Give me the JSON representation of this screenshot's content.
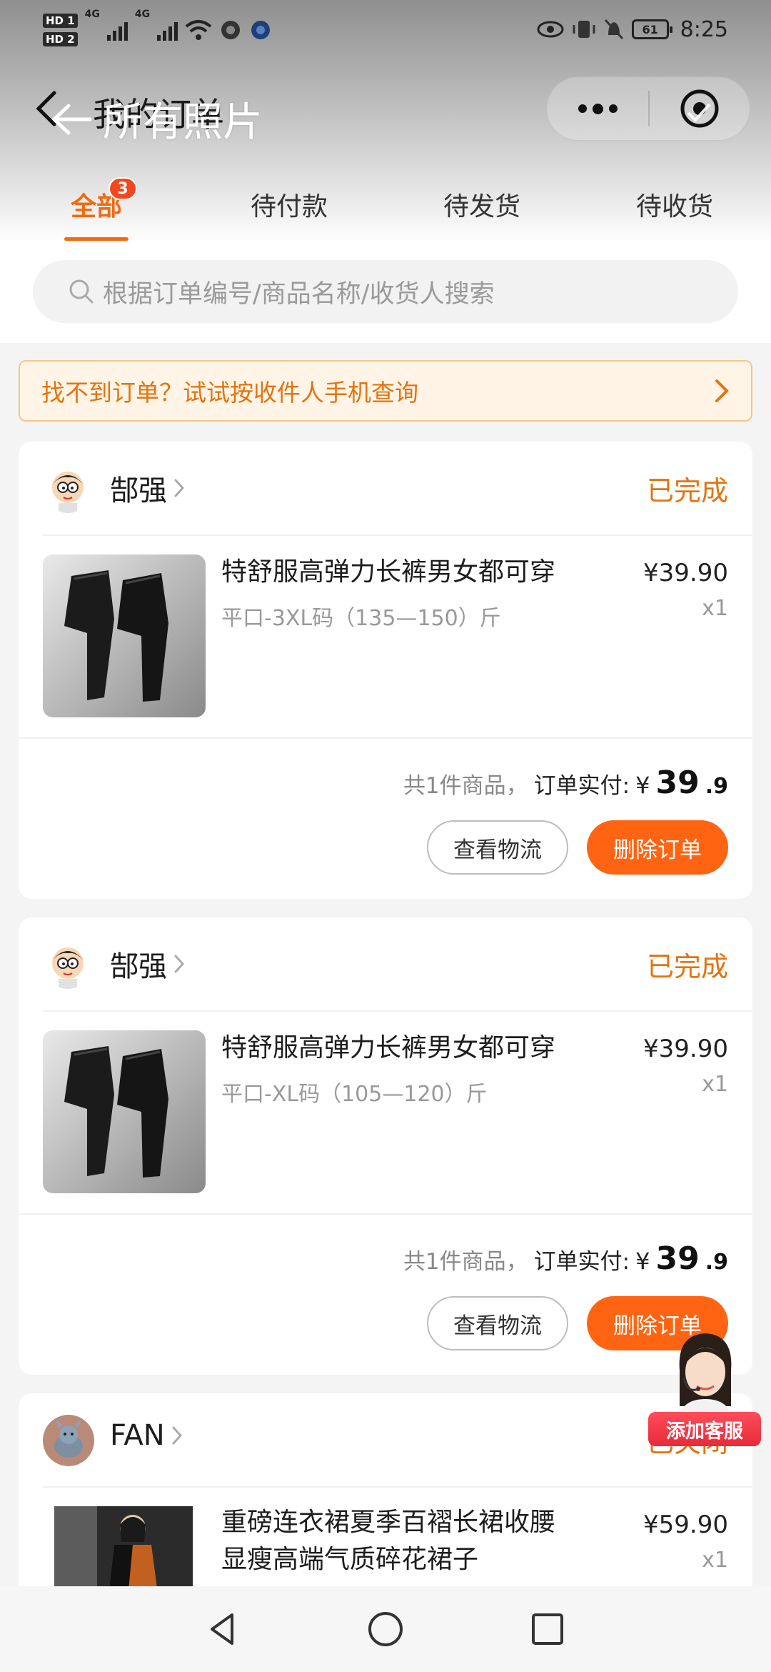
{
  "status_bar": {
    "hd1": "HD 1",
    "hd2": "HD 2",
    "net1": "4G",
    "net2": "4G",
    "battery": "61",
    "time": "8:25"
  },
  "header": {
    "title": "我的订单",
    "overlay_title": "所有照片"
  },
  "tabs": [
    {
      "label": "全部",
      "badge": "3",
      "active": true
    },
    {
      "label": "待付款"
    },
    {
      "label": "待发货"
    },
    {
      "label": "待收货"
    }
  ],
  "search": {
    "placeholder": "根据订单编号/商品名称/收货人搜索"
  },
  "notice": {
    "text": "找不到订单？试试按收件人手机查询"
  },
  "orders": [
    {
      "shop": "郜强",
      "status": "已完成",
      "product_title": "特舒服高弹力长裤男女都可穿",
      "spec": "平口-3XL码（135—150）斤",
      "price": "¥39.90",
      "qty": "x1",
      "summary_count": "共1件商品，",
      "summary_paid": "订单实付:",
      "summary_yen": "¥",
      "summary_int": "39",
      "summary_dec": ".9",
      "btn_logistics": "查看物流",
      "btn_delete": "删除订单"
    },
    {
      "shop": "郜强",
      "status": "已完成",
      "product_title": "特舒服高弹力长裤男女都可穿",
      "spec": "平口-XL码（105—120）斤",
      "price": "¥39.90",
      "qty": "x1",
      "summary_count": "共1件商品，",
      "summary_paid": "订单实付:",
      "summary_yen": "¥",
      "summary_int": "39",
      "summary_dec": ".9",
      "btn_logistics": "查看物流",
      "btn_delete": "删除订单"
    },
    {
      "shop": "FAN",
      "status": "已关闭",
      "product_title_line1": "重磅连衣裙夏季百褶长裙收腰",
      "product_title_line2": "显瘦高端气质碎花裙子",
      "price": "¥59.90",
      "qty": "x1"
    }
  ],
  "service": {
    "label": "添加客服"
  },
  "colors": {
    "accent": "#f26a10",
    "button": "#ff6412",
    "notice_bg": "#fff4e6",
    "status": "#e5730f"
  }
}
